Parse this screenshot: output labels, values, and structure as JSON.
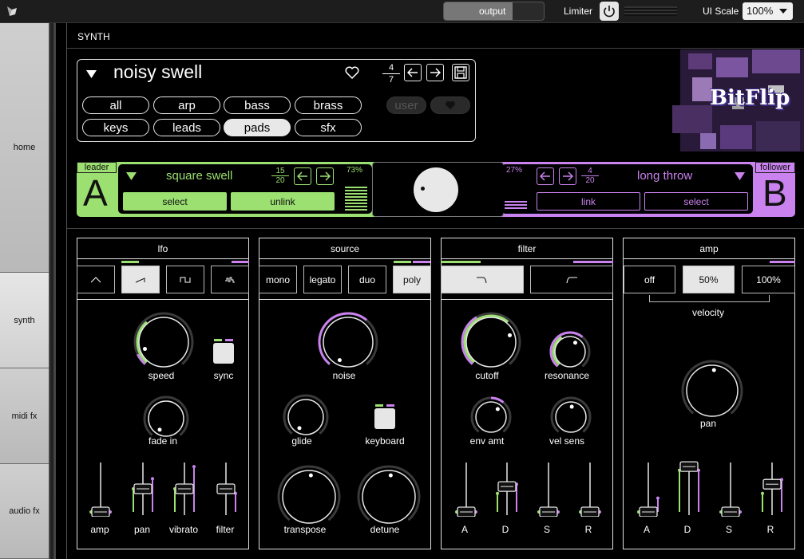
{
  "topbar": {
    "output_label": "output",
    "limiter_label": "Limiter",
    "ui_scale_label": "UI Scale",
    "ui_scale_value": "100%"
  },
  "sidebar": {
    "items": [
      {
        "label": "home"
      },
      {
        "label": "synth"
      },
      {
        "label": "midi fx"
      },
      {
        "label": "audio fx"
      }
    ]
  },
  "header": {
    "title": "SYNTH"
  },
  "preset": {
    "name": "noisy swell",
    "page_num": "4",
    "page_den": "7",
    "categories": [
      "all",
      "arp",
      "bass",
      "brass",
      "keys",
      "leads",
      "pads",
      "sfx"
    ],
    "selected": "pads",
    "user_label": "user"
  },
  "logo": {
    "text": "BitFlip"
  },
  "leader": {
    "tag": "leader",
    "letter": "A",
    "preset": "square swell",
    "num": "15",
    "den": "20",
    "percent": "73%",
    "select_label": "select",
    "unlink_label": "unlink"
  },
  "follower": {
    "tag": "follower",
    "letter": "B",
    "preset": "long throw",
    "num": "4",
    "den": "20",
    "percent": "27%",
    "link_label": "link",
    "select_label": "select"
  },
  "lfo": {
    "title": "lfo",
    "knobs": [
      "speed",
      "fade in"
    ],
    "sync_label": "sync",
    "sliders": [
      "amp",
      "pan",
      "vibrato",
      "filter"
    ]
  },
  "source": {
    "title": "source",
    "modes": [
      "mono",
      "legato",
      "duo",
      "poly"
    ],
    "knobs": [
      "noise",
      "glide"
    ],
    "keyboard_label": "keyboard",
    "big_knobs": [
      "transpose",
      "detune"
    ]
  },
  "filter": {
    "title": "filter",
    "knobs": [
      "cutoff",
      "resonance",
      "env amt",
      "vel sens"
    ],
    "adsr": [
      "A",
      "D",
      "S",
      "R"
    ]
  },
  "amp": {
    "title": "amp",
    "velocity_opts": [
      "off",
      "50%",
      "100%"
    ],
    "velocity_label": "velocity",
    "pan_label": "pan",
    "adsr": [
      "A",
      "D",
      "S",
      "R"
    ]
  },
  "colors": {
    "green": "#9be070",
    "purple": "#c982ee",
    "bg": "#000000"
  }
}
